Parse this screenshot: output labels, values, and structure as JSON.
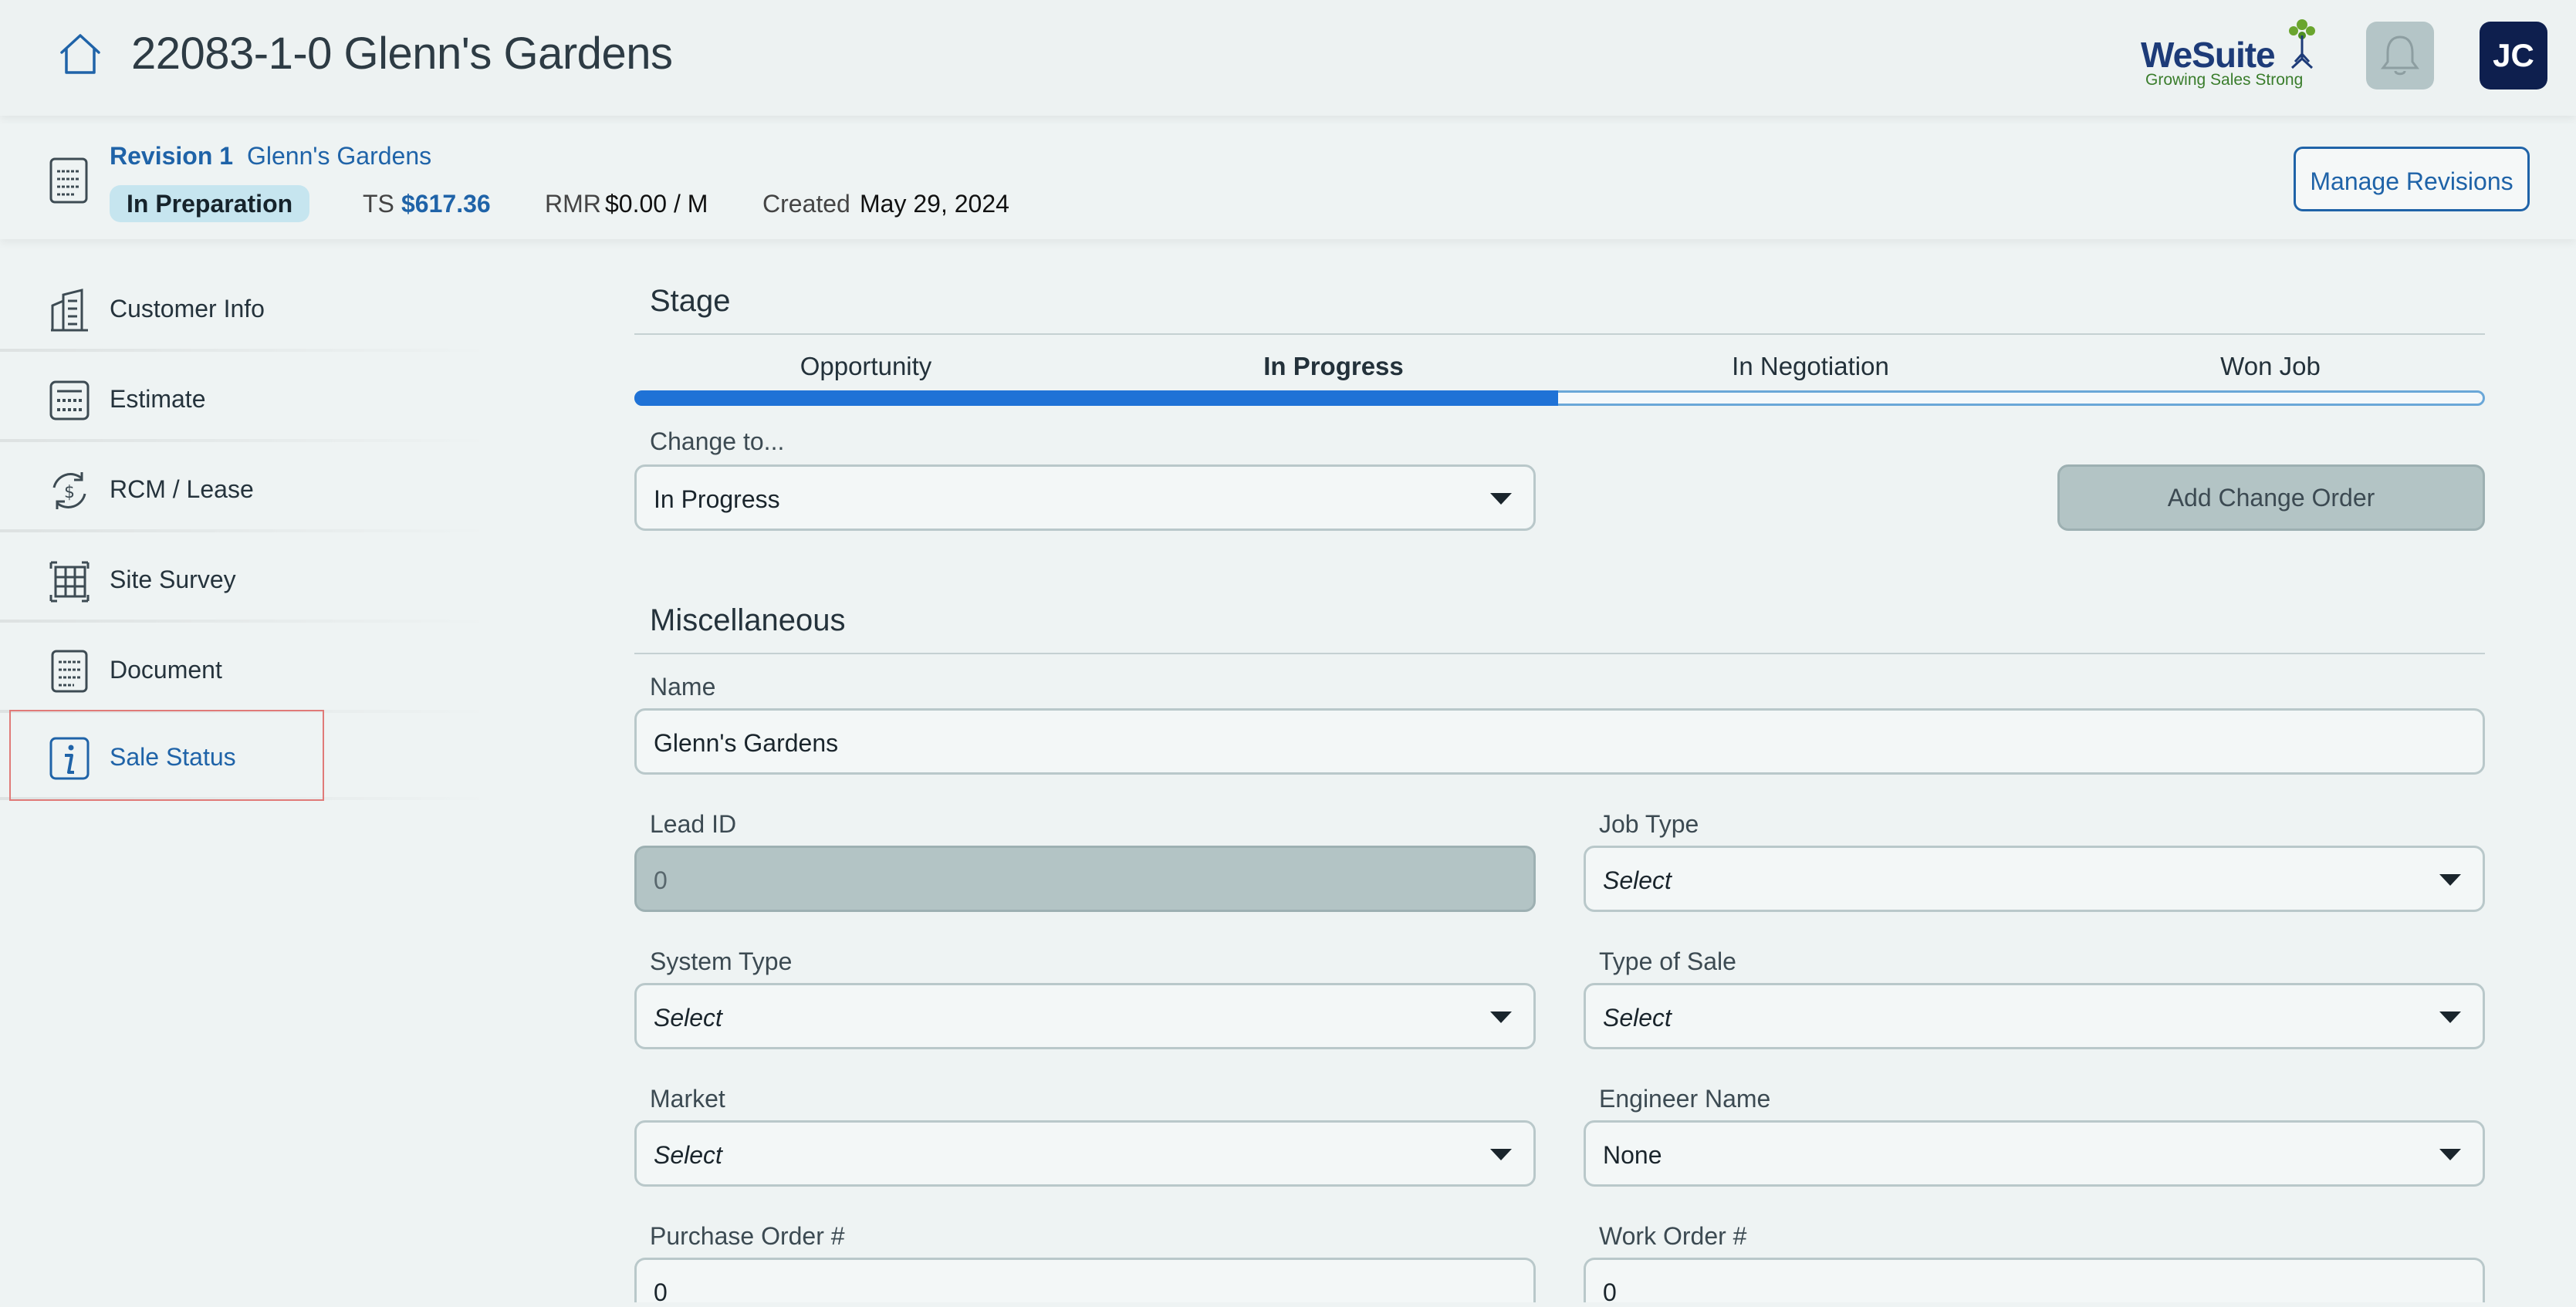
{
  "header": {
    "title": "22083-1-0 Glenn's Gardens",
    "logo": {
      "word": "WeSuite",
      "tagline": "Growing Sales Strong"
    },
    "user_initials": "JC"
  },
  "revision": {
    "label": "Revision 1",
    "name": "Glenn's Gardens",
    "status_badge": "In Preparation",
    "ts_label": "TS",
    "ts_value": "$617.36",
    "rmr_label": "RMR",
    "rmr_value": "$0.00 / M",
    "created_label": "Created",
    "created_value": "May 29, 2024",
    "manage_button": "Manage Revisions"
  },
  "sidebar": {
    "items": [
      {
        "label": "Customer Info",
        "icon": "building-icon"
      },
      {
        "label": "Estimate",
        "icon": "calculator-icon"
      },
      {
        "label": "RCM / Lease",
        "icon": "dollar-cycle-icon"
      },
      {
        "label": "Site Survey",
        "icon": "grid-icon"
      },
      {
        "label": "Document",
        "icon": "document-icon"
      },
      {
        "label": "Sale Status",
        "icon": "info-icon",
        "active": true
      }
    ]
  },
  "stage": {
    "title": "Stage",
    "steps": [
      "Opportunity",
      "In Progress",
      "In Negotiation",
      "Won Job"
    ],
    "current_step": "In Progress",
    "progress_fraction": 0.5,
    "change_to_label": "Change to...",
    "change_to_value": "In Progress",
    "add_change_order": "Add Change Order"
  },
  "misc": {
    "title": "Miscellaneous",
    "name_label": "Name",
    "name_value": "Glenn's Gardens",
    "lead_id_label": "Lead ID",
    "lead_id_value": "0",
    "job_type_label": "Job Type",
    "job_type_value": "Select",
    "system_type_label": "System Type",
    "system_type_value": "Select",
    "type_of_sale_label": "Type of Sale",
    "type_of_sale_value": "Select",
    "market_label": "Market",
    "market_value": "Select",
    "engineer_label": "Engineer Name",
    "engineer_value": "None",
    "po_label": "Purchase Order #",
    "po_value": "0",
    "wo_label": "Work Order #",
    "wo_value": "0"
  },
  "colors": {
    "accent": "#1f63a8",
    "progress": "#1f72d6",
    "background": "#eef3f3",
    "avatar_bg": "#0e1f4e"
  }
}
